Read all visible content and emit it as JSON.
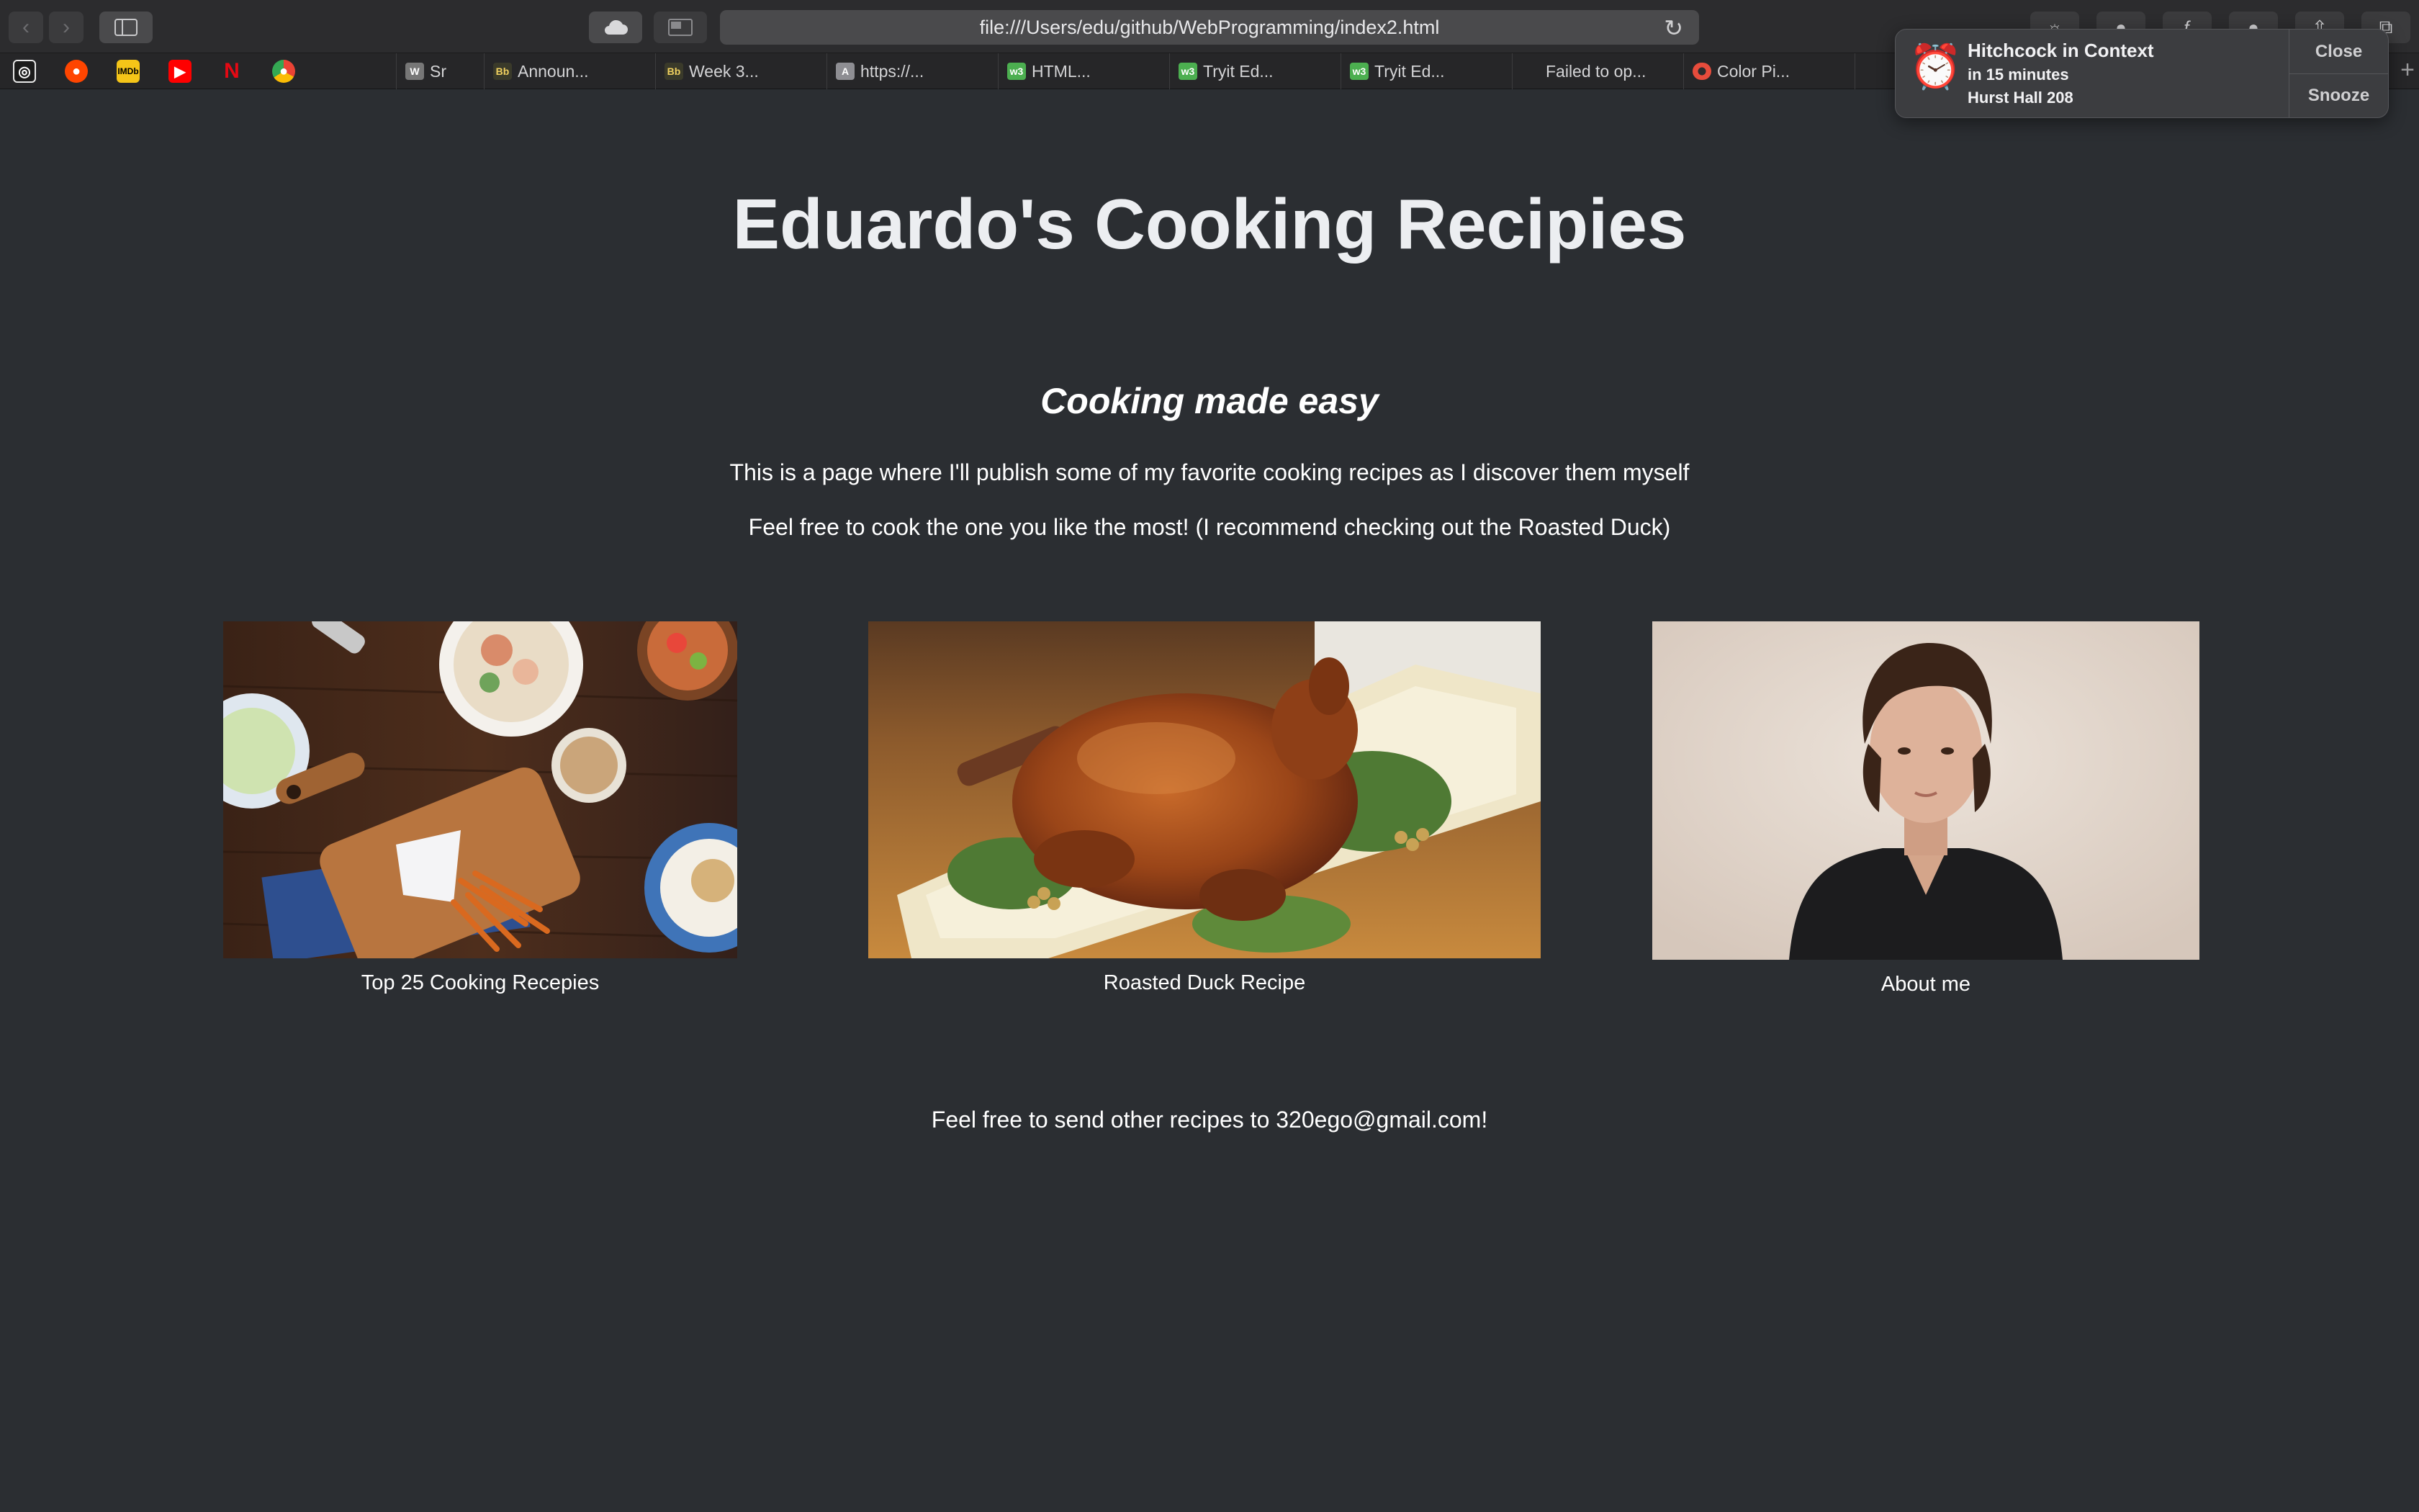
{
  "browser": {
    "url": "file:///Users/edu/github/WebProgramming/index2.html",
    "tabs": [
      {
        "label": "Sr",
        "icon": "wikipedia-icon"
      },
      {
        "label": "Announ...",
        "icon": "blackboard-icon"
      },
      {
        "label": "Week 3...",
        "icon": "blackboard-icon"
      },
      {
        "label": "https://...",
        "icon": "letter-a-icon"
      },
      {
        "label": "HTML...",
        "icon": "w3schools-icon"
      },
      {
        "label": "Tryit Ed...",
        "icon": "w3schools-icon"
      },
      {
        "label": "Tryit Ed...",
        "icon": "w3schools-icon"
      },
      {
        "label": "Failed to op...",
        "icon": ""
      },
      {
        "label": "Color Pi...",
        "icon": "color-picker-icon"
      }
    ],
    "favorites": [
      "instagram-icon",
      "reddit-icon",
      "imdb-icon",
      "youtube-icon",
      "netflix-icon",
      "chrome-icon"
    ]
  },
  "notification": {
    "title": "Hitchcock in Context",
    "time": "in 15 minutes",
    "location": "Hurst Hall 208",
    "close_label": "Close",
    "snooze_label": "Snooze"
  },
  "page": {
    "title": "Eduardo's Cooking Recipies",
    "subtitle": "Cooking made easy",
    "intro": "This is a page where I'll publish some of my favorite cooking recipes as I discover them myself",
    "recommend": "Feel free to cook the one you like the most! (I recommend checking out the Roasted Duck)",
    "cards": [
      {
        "caption": "Top 25 Cooking Recepies"
      },
      {
        "caption": "Roasted Duck Recipe"
      },
      {
        "caption": "About me"
      }
    ],
    "footer": "Feel free to send other recipes to 320ego@gmail.com!"
  },
  "colors": {
    "page_bg": "#2b2e32",
    "chrome_bg": "#2c2c2e"
  }
}
